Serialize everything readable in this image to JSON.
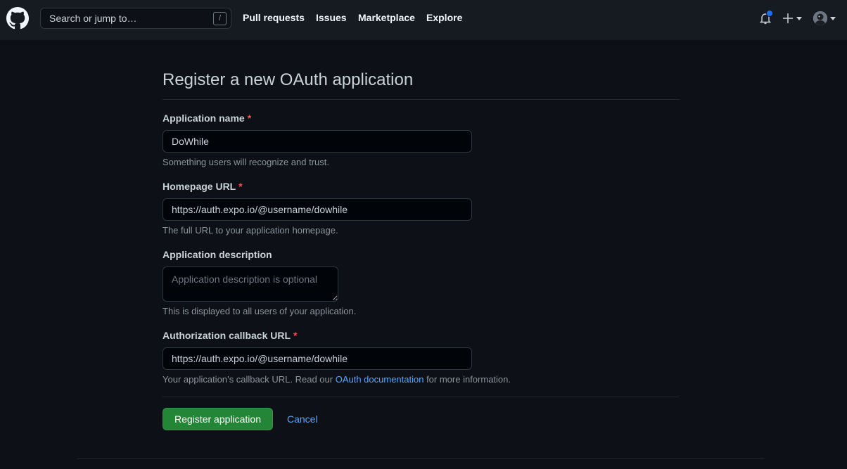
{
  "header": {
    "search_placeholder": "Search or jump to…",
    "search_shortcut": "/",
    "nav": [
      "Pull requests",
      "Issues",
      "Marketplace",
      "Explore"
    ]
  },
  "form": {
    "title": "Register a new OAuth application",
    "required_marker": "*",
    "app_name": {
      "label": "Application name",
      "value": "DoWhile",
      "note": "Something users will recognize and trust."
    },
    "homepage_url": {
      "label": "Homepage URL",
      "value": "https://auth.expo.io/@username/dowhile",
      "note": "The full URL to your application homepage."
    },
    "description": {
      "label": "Application description",
      "placeholder": "Application description is optional",
      "note": "This is displayed to all users of your application."
    },
    "callback_url": {
      "label": "Authorization callback URL",
      "value": "https://auth.expo.io/@username/dowhile",
      "note_before": "Your application’s callback URL. Read our ",
      "note_link": "OAuth documentation",
      "note_after": " for more information."
    },
    "register_label": "Register application",
    "cancel_label": "Cancel"
  },
  "colors": {
    "background": "#0d1117",
    "header": "#161b22",
    "primary_button": "#238636",
    "link": "#58a6ff",
    "required": "#f85149",
    "notification_dot": "#1f6feb"
  },
  "icons": [
    "github-logo-icon",
    "bell-icon",
    "plus-icon",
    "caret-down-icon",
    "avatar"
  ]
}
